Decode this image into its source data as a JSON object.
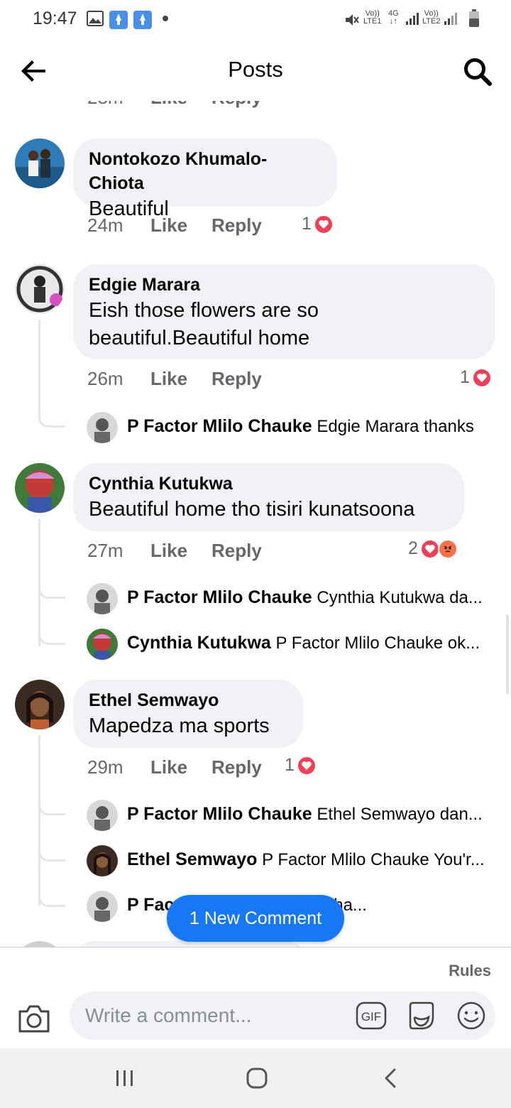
{
  "status_bar": {
    "time": "19:47",
    "sim1": "LTE1",
    "sim2": "LTE2",
    "network": "4G",
    "volte1": "Vo))",
    "volte2": "Vo))"
  },
  "header": {
    "title": "Posts"
  },
  "partial_top_meta": {
    "time": "23m",
    "like": "Like",
    "reply": "Reply"
  },
  "comments": [
    {
      "author": "Nontokozo Khumalo-Chiota",
      "text": "Beautiful",
      "time": "24m",
      "like": "Like",
      "reply": "Reply",
      "reaction_count": "1",
      "reactions": [
        "heart"
      ]
    },
    {
      "author": "Edgie Marara",
      "text_line1": "Eish those flowers are so",
      "text_line2": "beautiful.Beautiful home",
      "time": "26m",
      "like": "Like",
      "reply": "Reply",
      "reaction_count": "1",
      "reactions": [
        "heart"
      ],
      "replies": [
        {
          "author": "P Factor Mlilo Chauke",
          "text": "Edgie Marara thanks"
        }
      ]
    },
    {
      "author": "Cynthia Kutukwa",
      "text": "Beautiful home tho tisiri kunatsoona",
      "time": "27m",
      "like": "Like",
      "reply": "Reply",
      "reaction_count": "2",
      "reactions": [
        "heart",
        "angry"
      ],
      "replies": [
        {
          "author": "P Factor Mlilo Chauke",
          "text": "Cynthia Kutukwa da..."
        },
        {
          "author": "Cynthia Kutukwa",
          "text": "P Factor Mlilo Chauke ok..."
        }
      ]
    },
    {
      "author": "Ethel Semwayo",
      "text": "Mapedza ma sports",
      "time": "29m",
      "like": "Like",
      "reply": "Reply",
      "reaction_count": "1",
      "reactions": [
        "heart"
      ],
      "replies": [
        {
          "author": "P Factor Mlilo Chauke",
          "text": "Ethel Semwayo dan..."
        },
        {
          "author": "Ethel Semwayo",
          "text": "P Factor Mlilo Chauke You'r..."
        },
        {
          "author": "P Fac",
          "text": "hel Semwayo Tha..."
        }
      ]
    }
  ],
  "new_comment_pill": "1 New Comment",
  "composer": {
    "rules": "Rules",
    "placeholder": "Write a comment...",
    "gif": "GIF"
  },
  "icons": {
    "back": "arrow-left-icon",
    "search": "search-icon",
    "camera": "camera-icon",
    "gif": "gif-icon",
    "sticker": "sticker-icon",
    "emoji": "emoji-icon",
    "heart": "heart-reaction-icon",
    "angry": "angry-reaction-icon"
  },
  "colors": {
    "accent": "#1877f2",
    "bubble": "#f0f2f5",
    "secondary_text": "#65676b",
    "heart": "#f33e58",
    "angry": "#f7714b"
  }
}
